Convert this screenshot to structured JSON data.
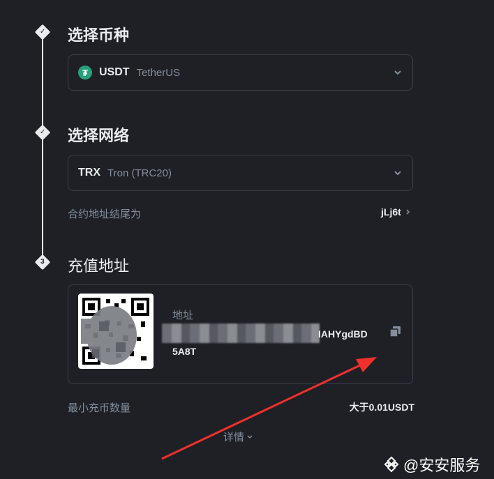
{
  "steps": [
    {
      "marker": "✓",
      "title": "选择币种"
    },
    {
      "marker": "✓",
      "title": "选择网络"
    },
    {
      "marker": "3",
      "title": "充值地址"
    }
  ],
  "coin": {
    "symbol": "USDT",
    "name": "TetherUS",
    "icon": "tether-icon",
    "accent": "#26a17b"
  },
  "network": {
    "symbol": "TRX",
    "name": "Tron (TRC20)"
  },
  "contract": {
    "label": "合约地址结尾为",
    "value": "jLj6t"
  },
  "deposit": {
    "address_label": "地址",
    "address_line1_visible": "IAHYgdBD",
    "address_line2": "5A8T"
  },
  "min_deposit": {
    "label": "最小充币数量",
    "value": "大于0.01USDT"
  },
  "details": {
    "label": "详情"
  },
  "watermark": {
    "text": "@安安服务"
  }
}
